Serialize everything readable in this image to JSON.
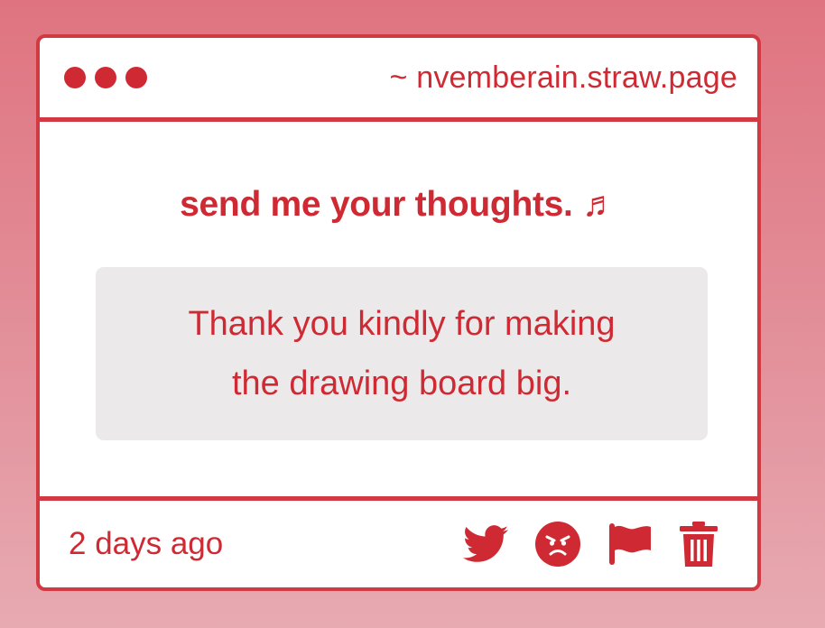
{
  "window": {
    "url": "~ nvemberain.straw.page"
  },
  "main": {
    "heading": "send me your thoughts. ♬",
    "message_line1": "Thank you kindly for making",
    "message_line2": "the drawing board big."
  },
  "footer": {
    "timestamp": "2 days ago",
    "actions": [
      {
        "icon": "twitter-icon"
      },
      {
        "icon": "angry-face-icon"
      },
      {
        "icon": "flag-icon"
      },
      {
        "icon": "trash-icon"
      }
    ]
  },
  "colors": {
    "accent": "#cf2a33",
    "background": "#df7480",
    "message_bg": "#ebe9ea"
  }
}
